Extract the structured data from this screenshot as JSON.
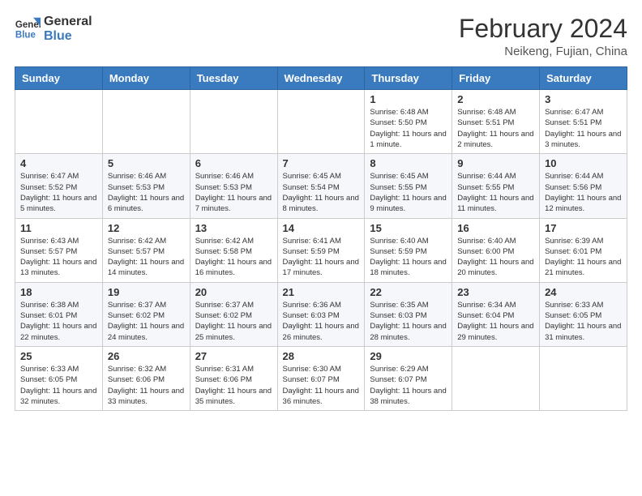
{
  "header": {
    "logo_general": "General",
    "logo_blue": "Blue",
    "month_year": "February 2024",
    "location": "Neikeng, Fujian, China"
  },
  "days_of_week": [
    "Sunday",
    "Monday",
    "Tuesday",
    "Wednesday",
    "Thursday",
    "Friday",
    "Saturday"
  ],
  "weeks": [
    [
      {
        "day": "",
        "info": ""
      },
      {
        "day": "",
        "info": ""
      },
      {
        "day": "",
        "info": ""
      },
      {
        "day": "",
        "info": ""
      },
      {
        "day": "1",
        "info": "Sunrise: 6:48 AM\nSunset: 5:50 PM\nDaylight: 11 hours and 1 minute."
      },
      {
        "day": "2",
        "info": "Sunrise: 6:48 AM\nSunset: 5:51 PM\nDaylight: 11 hours and 2 minutes."
      },
      {
        "day": "3",
        "info": "Sunrise: 6:47 AM\nSunset: 5:51 PM\nDaylight: 11 hours and 3 minutes."
      }
    ],
    [
      {
        "day": "4",
        "info": "Sunrise: 6:47 AM\nSunset: 5:52 PM\nDaylight: 11 hours and 5 minutes."
      },
      {
        "day": "5",
        "info": "Sunrise: 6:46 AM\nSunset: 5:53 PM\nDaylight: 11 hours and 6 minutes."
      },
      {
        "day": "6",
        "info": "Sunrise: 6:46 AM\nSunset: 5:53 PM\nDaylight: 11 hours and 7 minutes."
      },
      {
        "day": "7",
        "info": "Sunrise: 6:45 AM\nSunset: 5:54 PM\nDaylight: 11 hours and 8 minutes."
      },
      {
        "day": "8",
        "info": "Sunrise: 6:45 AM\nSunset: 5:55 PM\nDaylight: 11 hours and 9 minutes."
      },
      {
        "day": "9",
        "info": "Sunrise: 6:44 AM\nSunset: 5:55 PM\nDaylight: 11 hours and 11 minutes."
      },
      {
        "day": "10",
        "info": "Sunrise: 6:44 AM\nSunset: 5:56 PM\nDaylight: 11 hours and 12 minutes."
      }
    ],
    [
      {
        "day": "11",
        "info": "Sunrise: 6:43 AM\nSunset: 5:57 PM\nDaylight: 11 hours and 13 minutes."
      },
      {
        "day": "12",
        "info": "Sunrise: 6:42 AM\nSunset: 5:57 PM\nDaylight: 11 hours and 14 minutes."
      },
      {
        "day": "13",
        "info": "Sunrise: 6:42 AM\nSunset: 5:58 PM\nDaylight: 11 hours and 16 minutes."
      },
      {
        "day": "14",
        "info": "Sunrise: 6:41 AM\nSunset: 5:59 PM\nDaylight: 11 hours and 17 minutes."
      },
      {
        "day": "15",
        "info": "Sunrise: 6:40 AM\nSunset: 5:59 PM\nDaylight: 11 hours and 18 minutes."
      },
      {
        "day": "16",
        "info": "Sunrise: 6:40 AM\nSunset: 6:00 PM\nDaylight: 11 hours and 20 minutes."
      },
      {
        "day": "17",
        "info": "Sunrise: 6:39 AM\nSunset: 6:01 PM\nDaylight: 11 hours and 21 minutes."
      }
    ],
    [
      {
        "day": "18",
        "info": "Sunrise: 6:38 AM\nSunset: 6:01 PM\nDaylight: 11 hours and 22 minutes."
      },
      {
        "day": "19",
        "info": "Sunrise: 6:37 AM\nSunset: 6:02 PM\nDaylight: 11 hours and 24 minutes."
      },
      {
        "day": "20",
        "info": "Sunrise: 6:37 AM\nSunset: 6:02 PM\nDaylight: 11 hours and 25 minutes."
      },
      {
        "day": "21",
        "info": "Sunrise: 6:36 AM\nSunset: 6:03 PM\nDaylight: 11 hours and 26 minutes."
      },
      {
        "day": "22",
        "info": "Sunrise: 6:35 AM\nSunset: 6:03 PM\nDaylight: 11 hours and 28 minutes."
      },
      {
        "day": "23",
        "info": "Sunrise: 6:34 AM\nSunset: 6:04 PM\nDaylight: 11 hours and 29 minutes."
      },
      {
        "day": "24",
        "info": "Sunrise: 6:33 AM\nSunset: 6:05 PM\nDaylight: 11 hours and 31 minutes."
      }
    ],
    [
      {
        "day": "25",
        "info": "Sunrise: 6:33 AM\nSunset: 6:05 PM\nDaylight: 11 hours and 32 minutes."
      },
      {
        "day": "26",
        "info": "Sunrise: 6:32 AM\nSunset: 6:06 PM\nDaylight: 11 hours and 33 minutes."
      },
      {
        "day": "27",
        "info": "Sunrise: 6:31 AM\nSunset: 6:06 PM\nDaylight: 11 hours and 35 minutes."
      },
      {
        "day": "28",
        "info": "Sunrise: 6:30 AM\nSunset: 6:07 PM\nDaylight: 11 hours and 36 minutes."
      },
      {
        "day": "29",
        "info": "Sunrise: 6:29 AM\nSunset: 6:07 PM\nDaylight: 11 hours and 38 minutes."
      },
      {
        "day": "",
        "info": ""
      },
      {
        "day": "",
        "info": ""
      }
    ]
  ]
}
